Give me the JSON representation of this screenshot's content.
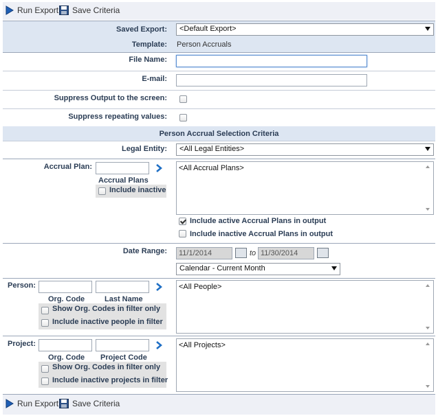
{
  "toolbar": {
    "run_export": "Run Export",
    "save_criteria": "Save Criteria"
  },
  "export": {
    "saved_export_label": "Saved Export:",
    "saved_export_value": "<Default Export>",
    "template_label": "Template:",
    "template_value": "Person Accruals",
    "file_name_label": "File Name:",
    "file_name_value": "",
    "email_label": "E-mail:",
    "email_value": "",
    "suppress_output_label": "Suppress Output to the screen:",
    "suppress_repeating_label": "Suppress repeating values:"
  },
  "criteria": {
    "section_title": "Person Accrual Selection Criteria",
    "legal_entity_label": "Legal Entity:",
    "legal_entity_value": "<All Legal Entities>",
    "accrual_plan_label": "Accrual Plan:",
    "accrual_plans_caption": "Accrual Plans",
    "include_inactive": "Include inactive",
    "accrual_plans_list": "<All Accrual Plans>",
    "include_active_output": "Include active Accrual Plans in output",
    "include_active_output_checked": true,
    "include_inactive_output": "Include inactive Accrual Plans in output",
    "date_range_label": "Date Range:",
    "date_from": "11/1/2014",
    "date_to_word": "to",
    "date_to": "11/30/2014",
    "date_preset": "Calendar - Current Month",
    "person_label": "Person:",
    "org_code_caption": "Org. Code",
    "last_name_caption": "Last Name",
    "person_show_org": "Show Org. Codes in filter only",
    "person_include_inactive": "Include inactive people in filter",
    "people_list": "<All People>",
    "project_label": "Project:",
    "project_org_code_caption": "Org. Code",
    "project_code_caption": "Project Code",
    "project_show_org": "Show Org. Codes in filter only",
    "project_include_inactive": "Include inactive projects in filter",
    "projects_list": "<All Projects>"
  },
  "icons": {
    "run": "play-icon",
    "save": "floppy-disk-icon",
    "go": "chevron-right-icon",
    "calendar": "calendar-icon"
  },
  "colors": {
    "header_band": "#dde6f2",
    "label_text": "#2b3d55",
    "accent_blue": "#1f5fb5"
  }
}
